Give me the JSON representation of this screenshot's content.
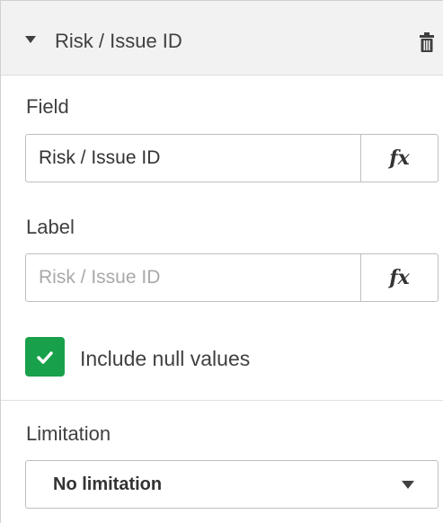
{
  "header": {
    "title": "Risk / Issue ID",
    "collapse_icon": "caret-down-icon",
    "delete_icon": "trash-icon"
  },
  "field": {
    "label": "Field",
    "value": "Risk / Issue ID",
    "fx_label": "fx"
  },
  "label_field": {
    "label": "Label",
    "placeholder": "Risk / Issue ID",
    "fx_label": "fx"
  },
  "include_null": {
    "label": "Include null values",
    "checked": true,
    "color": "#19a04a"
  },
  "limitation": {
    "label": "Limitation",
    "selected": "No limitation"
  }
}
